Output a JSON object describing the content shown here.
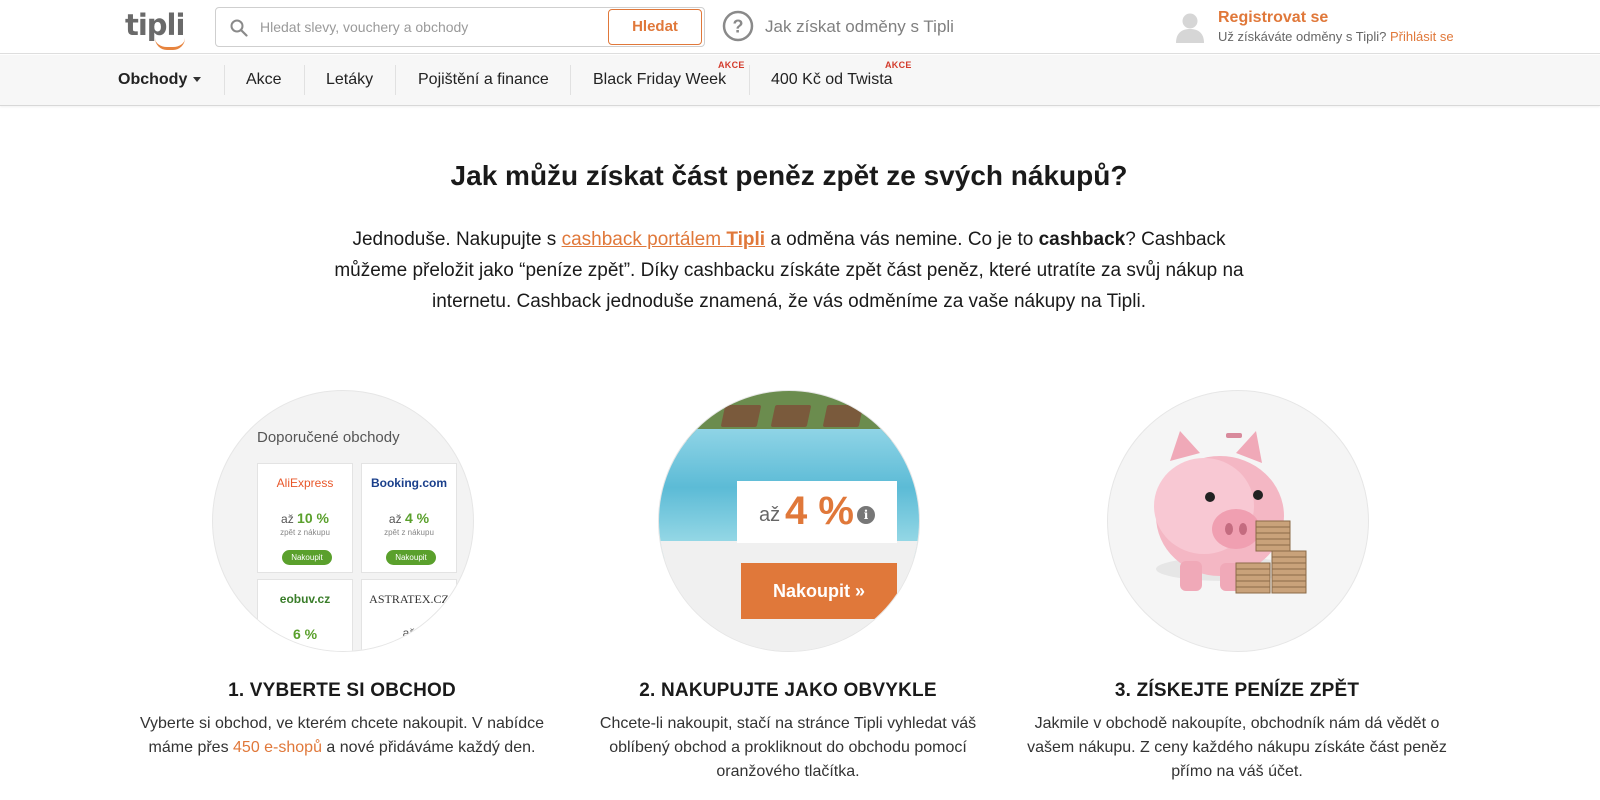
{
  "header": {
    "logo_text": "tipli",
    "search": {
      "placeholder": "Hledat slevy, vouchery a obchody",
      "button_label": "Hledat"
    },
    "help_text": "Jak získat odměny s Tipli",
    "account": {
      "register_label": "Registrovat se",
      "login_prompt": "Už získáváte odměny s Tipli?",
      "login_label": "Přihlásit se"
    }
  },
  "nav": {
    "items": [
      {
        "label": "Obchody",
        "badge": ""
      },
      {
        "label": "Akce",
        "badge": ""
      },
      {
        "label": "Letáky",
        "badge": ""
      },
      {
        "label": "Pojištění a finance",
        "badge": ""
      },
      {
        "label": "Black Friday Week",
        "badge": "AKCE"
      },
      {
        "label": "400 Kč od Twista",
        "badge": "AKCE"
      }
    ]
  },
  "main": {
    "title": "Jak můžu získat část peněz zpět ze svých nákupů?",
    "intro": {
      "part1": "Jednoduše. Nakupujte s ",
      "link_text": "cashback portálem ",
      "link_bold": "Tipli",
      "part2": " a odměna vás nemine. Co je to ",
      "bold": "cashback",
      "part3": "? Cashback můžeme přeložit jako “peníze zpět”. Díky cashbacku získáte zpět část peněz, které utratíte za svůj nákup na internetu. Cashback jednoduše znamená, že vás odměníme za vaše nákupy na Tipli."
    },
    "steps": [
      {
        "title": "1. VYBERTE SI OBCHOD",
        "text_before": "Vyberte si obchod, ve kterém chcete nakoupit. V nabídce máme přes ",
        "highlight": "450 e-shopů",
        "text_after": " a nové přidáváme každý den.",
        "visual": {
          "heading": "Doporučené obchody",
          "shops": [
            {
              "name": "AliExpress",
              "prefix": "až",
              "value": "10 %",
              "sub": "zpět z nákupu",
              "button": "Nakoupit"
            },
            {
              "name": "Booking.com",
              "prefix": "až",
              "value": "4 %",
              "sub": "zpět z nákupu",
              "button": "Nakoupit"
            },
            {
              "name": "eobuv.cz",
              "prefix": "",
              "value": "6 %",
              "sub": "",
              "button": ""
            },
            {
              "name": "ASTRATEX.CZ",
              "prefix": "až",
              "value": "",
              "sub": "",
              "button": ""
            }
          ]
        }
      },
      {
        "title": "2. NAKUPUJTE JAKO OBVYKLE",
        "text": "Chcete-li nakoupit, stačí na stránce Tipli vyhledat váš oblíbený obchod a prokliknout do obchodu pomocí oranžového tlačítka.",
        "visual": {
          "prefix": "až",
          "value": "4 %",
          "button": "Nakoupit »"
        }
      },
      {
        "title": "3. ZÍSKEJTE PENÍZE ZPĚT",
        "text": "Jakmile v obchodě nakoupíte, obchodník nám dá vědět o vašem nákupu. Z ceny každého nákupu získáte část peněz přímo na váš účet."
      }
    ]
  },
  "colors": {
    "accent": "#e0783a",
    "green": "#5aa02c",
    "badge": "#d33b2c",
    "text": "#1a1a1a"
  }
}
